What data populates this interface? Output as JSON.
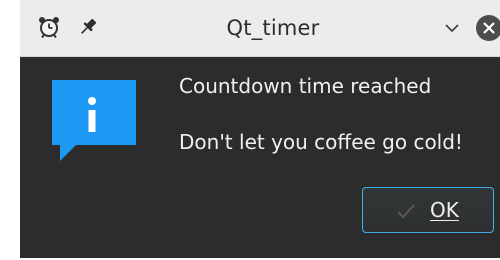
{
  "window": {
    "title": "Qt_timer",
    "titlebar_icons": [
      "alarm-clock-icon",
      "pin-icon"
    ],
    "controls": [
      "chevron-down-icon",
      "close-icon"
    ]
  },
  "dialog": {
    "type_icon": "info-icon",
    "message": "Countdown time reached",
    "detail": "Don't let you coffee go cold!",
    "ok_label": "OK",
    "ok_icon": "checkmark-icon"
  },
  "colors": {
    "titlebar": "#ececec",
    "dialog_background": "#2c2c2c",
    "text": "#f0f0f0",
    "info_icon": "#1d99f3",
    "button_focus": "#3daee9"
  }
}
